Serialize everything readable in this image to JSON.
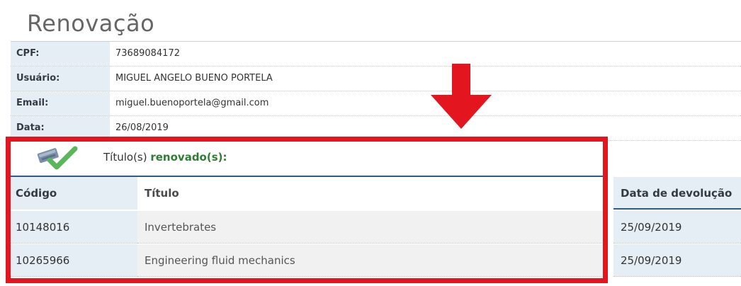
{
  "page": {
    "title": "Renovação"
  },
  "info": [
    {
      "label": "CPF:",
      "value": "73689084172"
    },
    {
      "label": "Usuário:",
      "value": "MIGUEL ANGELO BUENO PORTELA"
    },
    {
      "label": "Email:",
      "value": "miguel.buenoportela@gmail.com"
    },
    {
      "label": "Data:",
      "value": "26/08/2019"
    }
  ],
  "result": {
    "prefix": "Título(s) ",
    "emphasis": "renovado(s):",
    "icon": "renewal-check-icon"
  },
  "table": {
    "headers": [
      "Código",
      "Título",
      "Data de devolução"
    ],
    "rows": [
      [
        "10148016",
        "Invertebrates",
        "25/09/2019"
      ],
      [
        "10265966",
        "Engineering fluid mechanics",
        "25/09/2019"
      ]
    ]
  },
  "annotation": {
    "arrow_color": "#e3151f",
    "box_color": "#e3151f"
  },
  "colors": {
    "label_bg": "#e6eef5",
    "accent_blue": "#2a5d8a",
    "success_green": "#2f7d32"
  }
}
